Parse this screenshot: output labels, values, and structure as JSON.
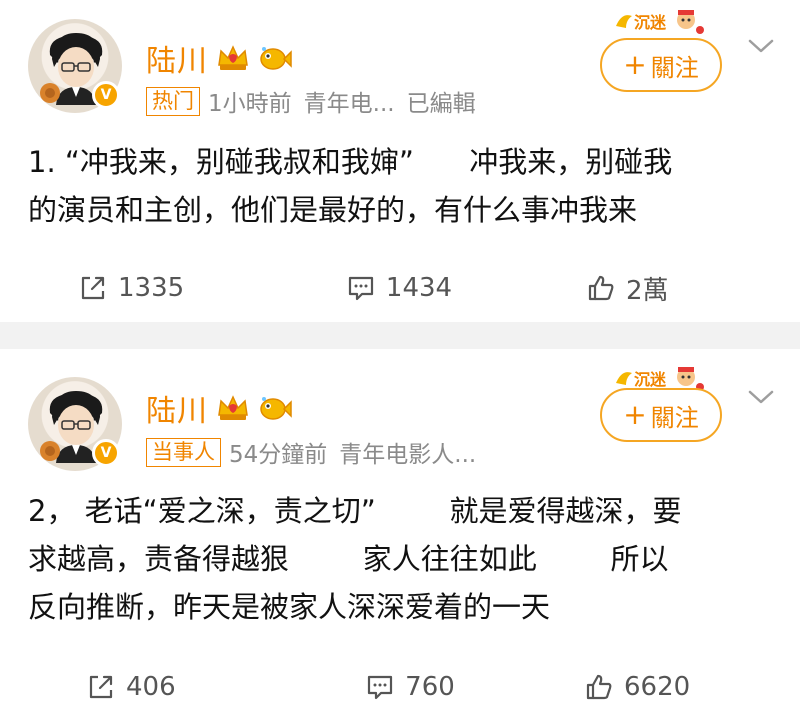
{
  "posts": [
    {
      "username": "陆川",
      "tag": "热门",
      "time": "1小時前",
      "source": "青年电...",
      "edited": "已編輯",
      "follow_label": "關注",
      "text": "1. “冲我来，别碰我叔和我婶”      冲我来，别碰我\n的演员和主创，他们是最好的，有什么事冲我来",
      "shares": "1335",
      "comments": "1434",
      "likes": "2萬"
    },
    {
      "username": "陆川",
      "tag": "当事人",
      "time": "54分鐘前",
      "source": "青年电影人...",
      "edited": "",
      "follow_label": "關注",
      "text": "2， 老话“爱之深，责之切”        就是爱得越深，要\n求越高，责备得越狠        家人往往如此        所以\n反向推断，昨天是被家人深深爱着的一天",
      "shares": "406",
      "comments": "760",
      "likes": "6620"
    }
  ],
  "badge_text": "沉迷",
  "colors": {
    "accent": "#f08500",
    "follow_border": "#f5a623",
    "muted": "#8a8a8a",
    "verified": "#f7a400"
  },
  "icons": [
    "crown-icon",
    "fish-icon",
    "verified-icon",
    "chevron-down-icon",
    "share-icon",
    "comment-icon",
    "like-icon"
  ]
}
